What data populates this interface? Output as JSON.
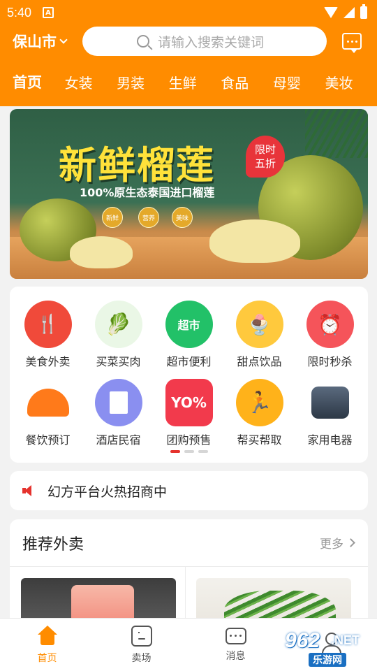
{
  "status_bar": {
    "time": "5:40",
    "notif_glyph": "A"
  },
  "header": {
    "city": "保山市",
    "search_placeholder": "请输入搜索关键词"
  },
  "tabs": [
    {
      "label": "首页",
      "active": true
    },
    {
      "label": "女装"
    },
    {
      "label": "男装"
    },
    {
      "label": "生鲜"
    },
    {
      "label": "食品"
    },
    {
      "label": "母婴"
    },
    {
      "label": "美妆"
    }
  ],
  "banner": {
    "title": "新鲜榴莲",
    "promo_line1": "限时",
    "promo_line2": "五折",
    "subtitle": "100%原生态泰国进口榴莲",
    "badges": [
      "新鲜",
      "营养",
      "美味"
    ]
  },
  "categories": [
    {
      "label": "美食外卖",
      "icon": "fork-spoon-icon",
      "color": "#f04a3a"
    },
    {
      "label": "买菜买肉",
      "icon": "vegetable-icon",
      "color": "#f2f2f2"
    },
    {
      "label": "超市便利",
      "icon": "supermarket-icon",
      "color": "#22c168",
      "icon_text": "超市"
    },
    {
      "label": "甜点饮品",
      "icon": "dessert-icon",
      "color": "#ffc93d"
    },
    {
      "label": "限时秒杀",
      "icon": "alarm-clock-icon",
      "color": "#f5545a"
    },
    {
      "label": "餐饮预订",
      "icon": "food-cover-icon",
      "color": "#ff7a1a"
    },
    {
      "label": "酒店民宿",
      "icon": "hotel-icon",
      "color": "#8a8ff0"
    },
    {
      "label": "团购预售",
      "icon": "coupon-icon",
      "color": "#f23a4c",
      "icon_text": "YO%"
    },
    {
      "label": "帮买帮取",
      "icon": "runner-icon",
      "color": "#ffb21a"
    },
    {
      "label": "家用电器",
      "icon": "rice-cooker-icon",
      "color": "#ffffff"
    }
  ],
  "notice": {
    "text": "幻方平台火热招商中"
  },
  "recommend": {
    "title": "推荐外卖",
    "more": "更多"
  },
  "bottom_nav": [
    {
      "label": "首页",
      "icon": "home-icon",
      "active": true
    },
    {
      "label": "卖场",
      "icon": "market-icon"
    },
    {
      "label": "消息",
      "icon": "message-icon"
    },
    {
      "label": "",
      "icon": "user-icon"
    }
  ],
  "watermark": {
    "num": "962",
    "suffix": ".NET",
    "cn": "乐游网"
  },
  "colors": {
    "brand": "#ff8c00",
    "accent_red": "#e5322d"
  }
}
